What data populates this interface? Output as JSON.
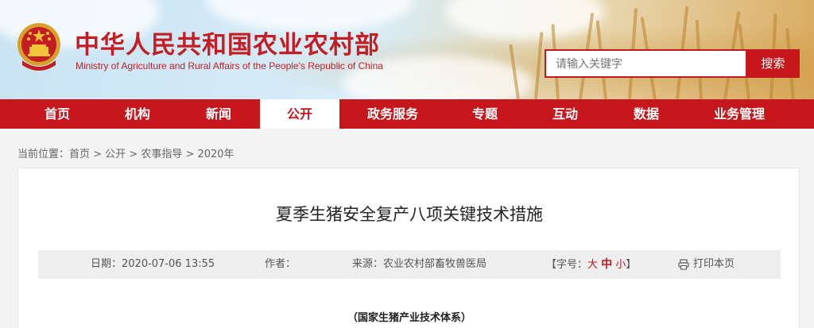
{
  "header": {
    "title": "中华人民共和国农业农村部",
    "subtitle": "Ministry of Agriculture and Rural Affairs of the People's Republic of China",
    "emblem_icon": "national-emblem-icon"
  },
  "search": {
    "placeholder": "请输入关键字",
    "button_label": "搜索"
  },
  "nav": {
    "items": [
      {
        "label": "首页"
      },
      {
        "label": "机构"
      },
      {
        "label": "新闻"
      },
      {
        "label": "公开"
      },
      {
        "label": "政务服务"
      },
      {
        "label": "专题"
      },
      {
        "label": "互动"
      },
      {
        "label": "数据"
      },
      {
        "label": "业务管理"
      }
    ],
    "active_label": "公开"
  },
  "breadcrumb": {
    "text": "当前位置：首页 > 公开 > 农事指导 > 2020年"
  },
  "article": {
    "title": "夏季生猪安全复产八项关键技术措施",
    "date_text": "日期：2020-07-06 13:55",
    "author_label": "作者：",
    "source_text": "来源：农业农村部畜牧兽医局",
    "font_size_prefix": "【字号：",
    "font_size_large": "大",
    "font_size_medium": "中",
    "font_size_small": "小",
    "font_size_suffix": "】",
    "print_label": "打印本页",
    "intro": "（国家生猪产业技术体系）"
  },
  "colors": {
    "brand_red": "#c6171d",
    "meta_bg": "#eeeeee"
  }
}
